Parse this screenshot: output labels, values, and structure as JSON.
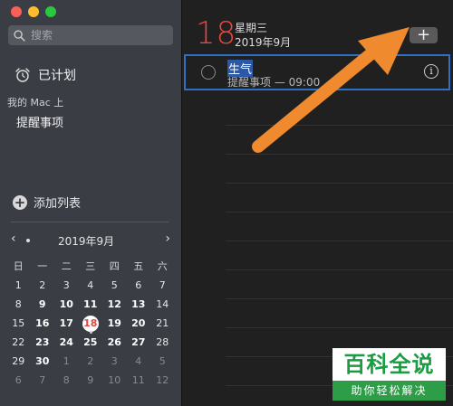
{
  "sidebar": {
    "search_placeholder": "搜索",
    "scheduled_label": "已计划",
    "section_header": "我的 Mac 上",
    "list_item": "提醒事项",
    "add_list_label": "添加列表"
  },
  "calendar": {
    "title": "2019年9月",
    "weekdays": [
      "日",
      "一",
      "二",
      "三",
      "四",
      "五",
      "六"
    ],
    "weeks": [
      [
        "1",
        "2",
        "3",
        "4",
        "5",
        "6",
        "7"
      ],
      [
        "8",
        "9",
        "10",
        "11",
        "12",
        "13",
        "14"
      ],
      [
        "15",
        "16",
        "17",
        "18",
        "19",
        "20",
        "21"
      ],
      [
        "22",
        "23",
        "24",
        "25",
        "26",
        "27",
        "28"
      ],
      [
        "29",
        "30",
        "1",
        "2",
        "3",
        "4",
        "5"
      ],
      [
        "6",
        "7",
        "8",
        "9",
        "10",
        "11",
        "12"
      ]
    ],
    "selected_day": "18"
  },
  "main": {
    "day_number": "18",
    "weekday": "星期三",
    "date": "2019年9月",
    "add_button": "+",
    "task": {
      "title": "生气",
      "subtitle": "提醒事项 — 09:00",
      "info_icon": "i"
    }
  },
  "watermark": {
    "top": "百科全说",
    "bottom": "助你轻松解决"
  },
  "colors": {
    "accent_red": "#e8463e",
    "selection_blue": "#2f6fc4",
    "arrow_orange": "#f08a2e",
    "watermark_green": "#2d9e47"
  }
}
